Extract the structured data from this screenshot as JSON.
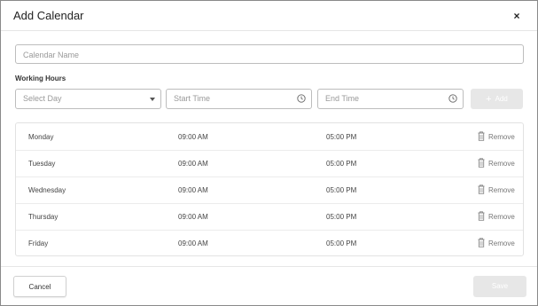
{
  "dialog": {
    "title": "Add Calendar",
    "close_label": "×"
  },
  "form": {
    "calendar_name_placeholder": "Calendar Name",
    "working_hours_label": "Working Hours",
    "day_placeholder": "Select Day",
    "start_time_placeholder": "Start Time",
    "end_time_placeholder": "End Time",
    "add_label": "Add",
    "add_icon": "+"
  },
  "schedule": [
    {
      "day": "Monday",
      "start": "09:00 AM",
      "end": "05:00 PM",
      "remove": "Remove"
    },
    {
      "day": "Tuesday",
      "start": "09:00 AM",
      "end": "05:00 PM",
      "remove": "Remove"
    },
    {
      "day": "Wednesday",
      "start": "09:00 AM",
      "end": "05:00 PM",
      "remove": "Remove"
    },
    {
      "day": "Thursday",
      "start": "09:00 AM",
      "end": "05:00 PM",
      "remove": "Remove"
    },
    {
      "day": "Friday",
      "start": "09:00 AM",
      "end": "05:00 PM",
      "remove": "Remove"
    }
  ],
  "footer": {
    "cancel_label": "Cancel",
    "save_label": "Save"
  },
  "colors": {
    "disabled_button": "#e7e7e7",
    "border": "#bdbdbd"
  },
  "icons": {
    "close": "close-icon",
    "dropdown": "chevron-down-icon",
    "clock": "clock-icon",
    "add": "plus-icon",
    "remove": "trash-icon"
  }
}
